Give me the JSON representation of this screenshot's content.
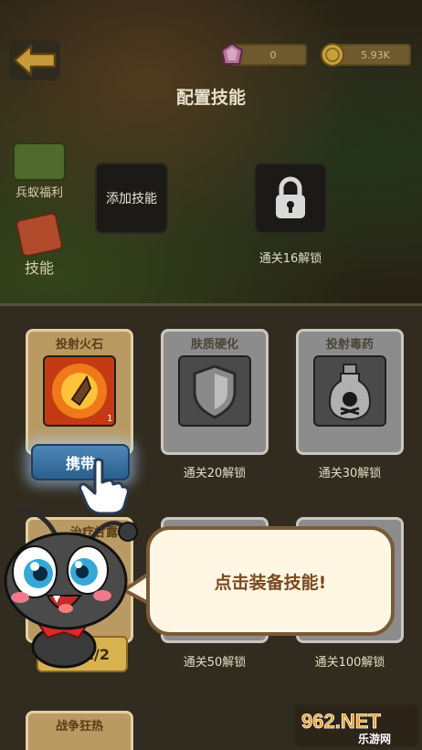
{
  "header": {
    "title": "配置技能",
    "gems": "0",
    "coins": "5.93K"
  },
  "sidebar": {
    "items": [
      {
        "label": "兵蚁福利"
      },
      {
        "label": "技能"
      }
    ]
  },
  "slots": {
    "add_label": "添加技能",
    "lock_note": "通关16解锁"
  },
  "skills": [
    {
      "name": "投射火石",
      "count": "1",
      "action": "携带"
    },
    {
      "name": "肤质硬化",
      "unlock": "通关20解锁"
    },
    {
      "name": "投射毒药",
      "unlock": "通关30解锁"
    },
    {
      "name": "治疗甘露",
      "level": "1/2"
    },
    {
      "unlock": "通关50解锁"
    },
    {
      "unlock": "通关100解锁"
    },
    {
      "name": "战争狂热"
    }
  ],
  "tutorial": {
    "message": "点击装备技能!"
  },
  "watermark": {
    "brand": "962.NET",
    "subtitle": "乐游网"
  },
  "colors": {
    "panel": "#3a3224",
    "card_active": "#b99a62",
    "card_locked": "#8c8c8c",
    "button_blue": "#3d76a8",
    "bubble_border": "#7a5a36",
    "bubble_text": "#7a4a20"
  }
}
